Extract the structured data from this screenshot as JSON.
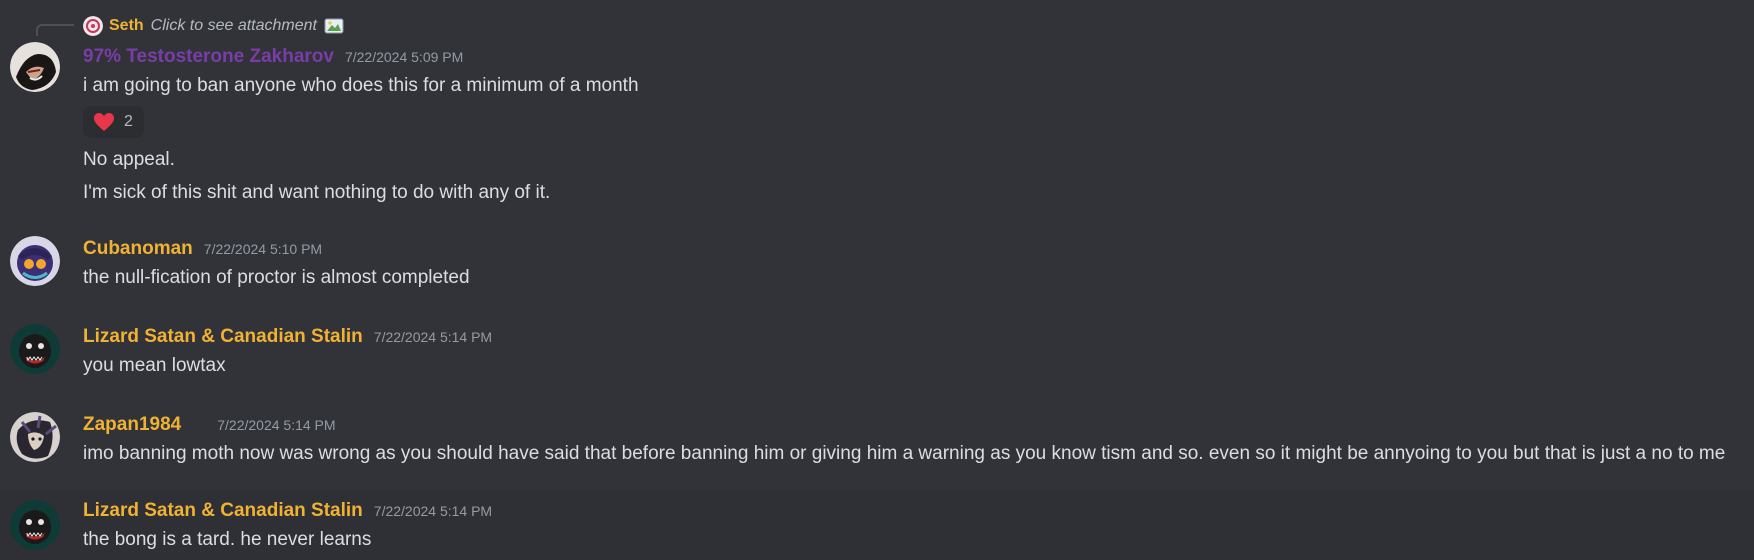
{
  "colors": {
    "background": "#313338",
    "hover_background": "#2e3035",
    "text": "#dbdee1",
    "timestamp": "#949ba4",
    "gold_name": "#f0b232",
    "purple_name": "#7a3da8",
    "heart": "#e8364a"
  },
  "reply": {
    "author": "Seth",
    "text": "Click to see attachment",
    "attachment_icon": "image-icon",
    "avatar_icon": "seth-avatar"
  },
  "messages": [
    {
      "author": "97% Testosterone Zakharov",
      "timestamp": "7/22/2024 5:09 PM",
      "avatar_icon": "zakharov-avatar",
      "lines": [
        "i am going to ban anyone who does this for a minimum of a month"
      ],
      "reaction": {
        "emoji": "heart-icon",
        "count": "2"
      },
      "followups": [
        "No appeal.",
        "I'm sick of this shit and want nothing to do with any of it."
      ]
    },
    {
      "author": "Cubanoman",
      "timestamp": "7/22/2024 5:10 PM",
      "avatar_icon": "cubanoman-avatar",
      "lines": [
        "the null-fication of proctor is almost completed"
      ]
    },
    {
      "author": "Lizard Satan & Canadian Stalin",
      "timestamp": "7/22/2024 5:14 PM",
      "avatar_icon": "lizard-avatar",
      "lines": [
        "you mean lowtax"
      ]
    },
    {
      "author": "Zapan1984",
      "timestamp": "7/22/2024 5:14 PM",
      "avatar_icon": "zapan-avatar",
      "lines": [
        "imo banning moth now was wrong as you should have said that before banning him or giving him a warning as you know tism and so. even so it might be annyoing to you but that is just a no to me"
      ]
    },
    {
      "author": "Lizard Satan & Canadian Stalin",
      "timestamp": "7/22/2024 5:14 PM",
      "avatar_icon": "lizard-avatar",
      "lines": [
        "the bong is a tard. he never learns"
      ]
    }
  ]
}
